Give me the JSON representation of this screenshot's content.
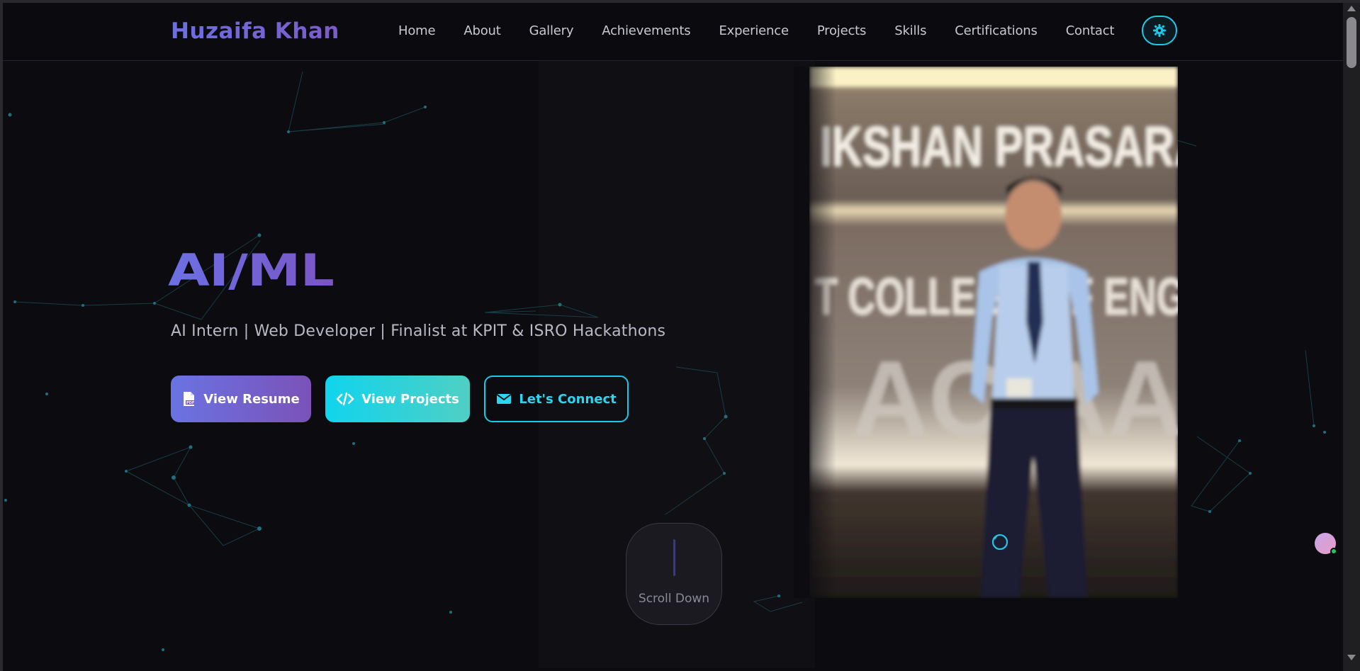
{
  "navbar": {
    "logo": "Huzaifa Khan",
    "links": [
      "Home",
      "About",
      "Gallery",
      "Achievements",
      "Experience",
      "Projects",
      "Skills",
      "Certifications",
      "Contact"
    ],
    "theme_icon": "gear-icon"
  },
  "hero": {
    "title": "AI/ML",
    "subtitle": "AI Intern | Web Developer | Finalist at KPIT & ISRO Hackathons",
    "buttons": {
      "resume": "View Resume",
      "projects": "View Projects",
      "connect": "Let's Connect"
    },
    "photo_text_top": "IKSHAN PRASARAI",
    "photo_text_mid": "T COLLEGE OF ENGINEER"
  },
  "scroll": {
    "label": "Scroll Down"
  },
  "colors": {
    "background": "#0b0b10",
    "accent_purple": "#6b70e4",
    "accent_cyan": "#1ec8e8"
  }
}
